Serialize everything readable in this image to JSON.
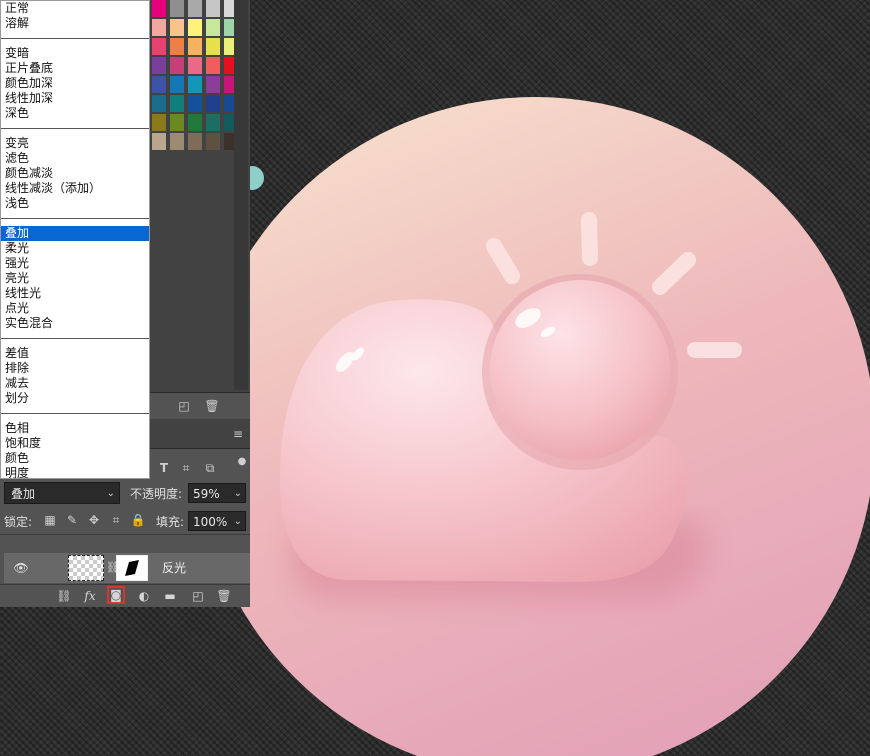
{
  "blend_menu": {
    "groups": [
      [
        "正常",
        "溶解"
      ],
      [
        "变暗",
        "正片叠底",
        "颜色加深",
        "线性加深",
        "深色"
      ],
      [
        "变亮",
        "滤色",
        "颜色减淡",
        "线性减淡（添加）",
        "浅色"
      ],
      [
        "叠加",
        "柔光",
        "强光",
        "亮光",
        "线性光",
        "点光",
        "实色混合"
      ],
      [
        "差值",
        "排除",
        "减去",
        "划分"
      ],
      [
        "色相",
        "饱和度",
        "颜色",
        "明度"
      ]
    ],
    "selected": "叠加"
  },
  "swatches": {
    "colors": [
      [
        "#e6007e",
        "#8f8f8f",
        "#a9a9a9",
        "#c6c6c6",
        "#d8d8d8"
      ],
      [
        "#f4a6a0",
        "#f7c58a",
        "#fff27a",
        "#c5e89a",
        "#9dd5a8"
      ],
      [
        "#e8436f",
        "#f07f45",
        "#f6b35e",
        "#e6e04b",
        "#e8f07a"
      ],
      [
        "#7a3f9c",
        "#c5407b",
        "#e96a86",
        "#f05d5d",
        "#e3101d"
      ],
      [
        "#3d53a8",
        "#1377b8",
        "#1397b6",
        "#8a3e9a",
        "#c8157a"
      ],
      [
        "#1b6b8a",
        "#0f7f7c",
        "#15519a",
        "#1f3f8f",
        "#174a8e"
      ],
      [
        "#8b7a1a",
        "#6a8a1f",
        "#1f7a3a",
        "#1a6e63",
        "#125a5c"
      ],
      [
        "#b9a68e",
        "#9c8a72",
        "#7e6c56",
        "#5f5142",
        "#3b312a"
      ]
    ]
  },
  "layers_panel": {
    "blend_mode": "叠加",
    "opacity_label": "不透明度:",
    "opacity_value": "59%",
    "lock_label": "锁定:",
    "fill_label": "填充:",
    "fill_value": "100%",
    "layer": {
      "name": "反光",
      "visible": true
    }
  },
  "icons": {
    "menu": "panel-menu-icon",
    "new_swatch": "new-swatch-icon",
    "delete": "trash-icon"
  }
}
